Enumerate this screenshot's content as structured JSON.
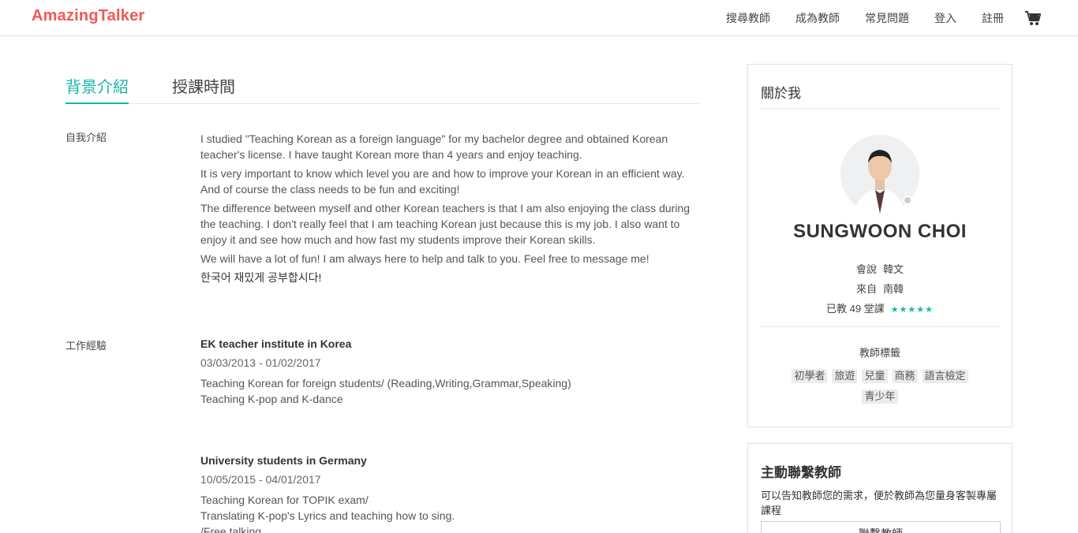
{
  "header": {
    "logo": "AmazingTalker",
    "nav": {
      "search_teachers": "搜尋教師",
      "become_teacher": "成為教師",
      "faq": "常見問題",
      "login": "登入",
      "signup": "註冊"
    },
    "cart_icon": "cart-icon"
  },
  "tabs": {
    "background": "背景介紹",
    "schedule": "授課時間"
  },
  "sections": {
    "intro_label": "自我介紹",
    "experience_label": "工作經驗"
  },
  "intro": {
    "p1": "I studied \"Teaching Korean as a foreign language\" for my bachelor degree and obtained Korean teacher's license. I have taught Korean more than 4 years and enjoy teaching.",
    "p2": "It is very important to know which level you are and how to improve your Korean in an efficient way. And of course the class needs to be fun and exciting!",
    "p3": "The difference between myself and other Korean teachers is that I am also enjoying the class during the teaching. I don't really feel that I am teaching Korean just because this is my job. I also want to enjoy it and see how much and how fast my students improve their Korean skills.",
    "p4": "We will have a lot of fun! I am always here to help and talk to you. Feel free to message me!",
    "p5": "한국어 재밌게 공부합시다!"
  },
  "experience": [
    {
      "title": "EK teacher institute in Korea",
      "date": "03/03/2013 - 01/02/2017",
      "line1": "Teaching Korean for foreign students/ (Reading,Writing,Grammar,Speaking)",
      "line2": "Teaching K-pop and K-dance"
    },
    {
      "title": "University students in Germany",
      "date": "10/05/2015 - 04/01/2017",
      "line1": "Teaching Korean for TOPIK exam/",
      "line2": "Translating K-pop's Lyrics and teaching how to sing.",
      "line3": "/Free talking"
    }
  ],
  "about": {
    "title": "關於我",
    "name": "SUNGWOON CHOI",
    "speaks_label": "會說",
    "speaks_value": "韓文",
    "from_label": "來自",
    "from_value": "南韓",
    "taught_text": "已教 49 堂課",
    "stars": "★★★★★",
    "rating": 5,
    "tags_title": "教師標籤",
    "tags": [
      "初學者",
      "旅遊",
      "兒童",
      "商務",
      "語言檢定",
      "青少年"
    ]
  },
  "contact": {
    "title": "主動聯繫教師",
    "desc": "可以告知教師您的需求，便於教師為您量身客製專屬課程",
    "button": "聯繫教師"
  },
  "colors": {
    "brand": "#f25858",
    "accent": "#1bb4a8"
  }
}
